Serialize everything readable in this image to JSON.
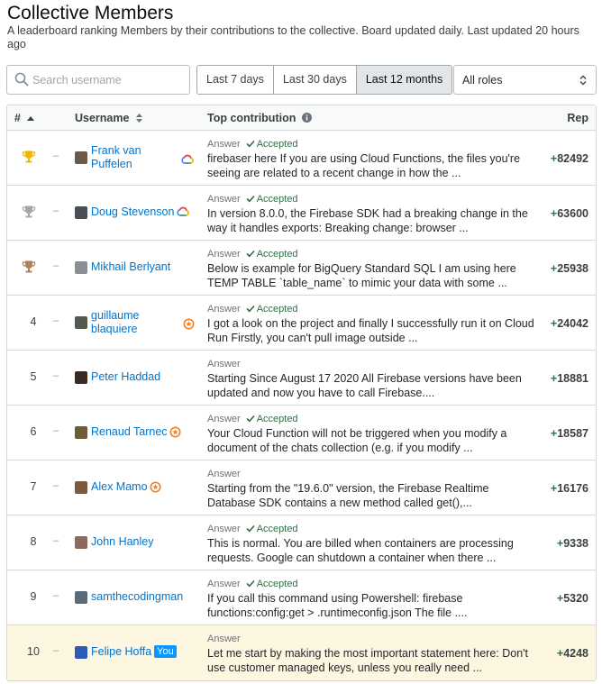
{
  "header": {
    "title": "Collective Members",
    "subtitle": "A leaderboard ranking Members by their contributions to the collective. Board updated daily. Last updated 20 hours ago"
  },
  "search": {
    "placeholder": "Search username",
    "value": ""
  },
  "time_filter": {
    "options": [
      "Last 7 days",
      "Last 30 days",
      "Last 12 months"
    ],
    "selected": "Last 12 months"
  },
  "roles_select": {
    "value": "All roles"
  },
  "table": {
    "columns": {
      "rank": "#",
      "username": "Username",
      "top_contribution": "Top contribution",
      "rep": "Rep"
    },
    "rows": [
      {
        "rank": "",
        "trophy": "gold",
        "dash": "–",
        "username_line1": "Frank van",
        "username_line2": "Puffelen",
        "badge": "google-cloud",
        "you": "",
        "type": "Answer",
        "accepted": "Accepted",
        "text": "firebaser here If you are using Cloud Functions, the files you're seeing are related to a recent change in how the ...",
        "rep_sign": "+",
        "rep": "82492"
      },
      {
        "rank": "",
        "trophy": "silver",
        "dash": "–",
        "username_line1": "Doug Stevenson",
        "username_line2": "",
        "badge": "google-cloud",
        "you": "",
        "type": "Answer",
        "accepted": "Accepted",
        "text": "In version 8.0.0, the Firebase SDK had a breaking change in the way it handles exports: Breaking change: browser ...",
        "rep_sign": "+",
        "rep": "63600"
      },
      {
        "rank": "",
        "trophy": "bronze",
        "dash": "–",
        "username_line1": "Mikhail Berlyant",
        "username_line2": "",
        "badge": "",
        "you": "",
        "type": "Answer",
        "accepted": "Accepted",
        "text": "Below is example for BigQuery Standard SQL I am using here TEMP TABLE `table_name` to mimic your data with some ...",
        "rep_sign": "+",
        "rep": "25938"
      },
      {
        "rank": "4",
        "trophy": "",
        "dash": "–",
        "username_line1": "guillaume",
        "username_line2": "blaquiere",
        "badge": "recognized",
        "you": "",
        "type": "Answer",
        "accepted": "Accepted",
        "text": "I got a look on the project and finally I successfully run it on Cloud Run Firstly, you can't pull image outside ...",
        "rep_sign": "+",
        "rep": "24042"
      },
      {
        "rank": "5",
        "trophy": "",
        "dash": "–",
        "username_line1": "Peter Haddad",
        "username_line2": "",
        "badge": "",
        "you": "",
        "type": "Answer",
        "accepted": "",
        "text": "Starting Since August 17 2020 All Firebase versions have been updated and now you have to call Firebase....",
        "rep_sign": "+",
        "rep": "18881"
      },
      {
        "rank": "6",
        "trophy": "",
        "dash": "–",
        "username_line1": "Renaud Tarnec",
        "username_line2": "",
        "badge": "recognized",
        "you": "",
        "type": "Answer",
        "accepted": "Accepted",
        "text": "Your Cloud Function will not be triggered when you modify a document of the chats collection (e.g. if you modify ...",
        "rep_sign": "+",
        "rep": "18587"
      },
      {
        "rank": "7",
        "trophy": "",
        "dash": "–",
        "username_line1": "Alex Mamo",
        "username_line2": "",
        "badge": "recognized",
        "you": "",
        "type": "Answer",
        "accepted": "",
        "text": "Starting from the \"19.6.0\" version, the Firebase Realtime Database SDK contains a new method called get(),...",
        "rep_sign": "+",
        "rep": "16176"
      },
      {
        "rank": "8",
        "trophy": "",
        "dash": "–",
        "username_line1": "John Hanley",
        "username_line2": "",
        "badge": "",
        "you": "",
        "type": "Answer",
        "accepted": "Accepted",
        "text": "This is normal. You are billed when containers are processing requests. Google can shutdown a container when there ...",
        "rep_sign": "+",
        "rep": "9338"
      },
      {
        "rank": "9",
        "trophy": "",
        "dash": "–",
        "username_line1": "samthecodingman",
        "username_line2": "",
        "badge": "",
        "you": "",
        "type": "Answer",
        "accepted": "Accepted",
        "text": "If you call this command using Powershell: firebase functions:config:get > .runtimeconfig.json The file ....",
        "rep_sign": "+",
        "rep": "5320"
      },
      {
        "rank": "10",
        "trophy": "",
        "dash": "–",
        "username_line1": "Felipe Hoffa",
        "username_line2": "",
        "badge": "",
        "you": "You",
        "type": "Answer",
        "accepted": "",
        "text": "Let me start by making the most important statement here: Don't use customer managed keys, unless you really need ...",
        "rep_sign": "+",
        "rep": "4248"
      }
    ]
  },
  "colors": {
    "link": "#0074cc",
    "accepted": "#2f6f44",
    "gold": "#f1b600",
    "silver": "#9fa6ad",
    "bronze": "#ab825f",
    "recognized_badge": "#f48024",
    "you_highlight": "#fdf7e2",
    "you_badge": "#0a95ff"
  },
  "avatar_colors": [
    "#6b5a4a",
    "#4a4f55",
    "#8a8f96",
    "#555a50",
    "#3a2a25",
    "#6d5c3a",
    "#7a5a40",
    "#8a6a5a",
    "#5a6a7a",
    "#2f5ab5"
  ]
}
